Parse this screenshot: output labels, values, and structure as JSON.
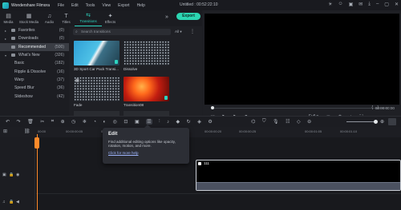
{
  "window": {
    "app_name": "Wondershare Filmora",
    "menu": [
      "File",
      "Edit",
      "Tools",
      "View",
      "Export",
      "Help"
    ],
    "title": "Untitled : 00:52:22:10"
  },
  "toolbar": {
    "tabs": [
      {
        "label": "Media",
        "icon": "media-icon"
      },
      {
        "label": "Stock Media",
        "icon": "stock-media-icon"
      },
      {
        "label": "Audio",
        "icon": "audio-icon"
      },
      {
        "label": "Titles",
        "icon": "titles-icon"
      },
      {
        "label": "Transitions",
        "icon": "transitions-icon"
      },
      {
        "label": "Effects",
        "icon": "effects-icon"
      }
    ],
    "active_tab": "Transitions",
    "export_label": "Export",
    "accent": "#2dd4c0"
  },
  "nav": {
    "items": [
      {
        "label": "Favorites",
        "count": "(0)"
      },
      {
        "label": "Downloads",
        "count": "(0)"
      },
      {
        "label": "Recommended",
        "count": "(500)",
        "selected": true
      },
      {
        "label": "What's New",
        "count": "(326)"
      },
      {
        "label": "Basic",
        "count": "(182)"
      },
      {
        "label": "Ripple & Dissolve",
        "count": "(16)"
      },
      {
        "label": "Warp",
        "count": "(37)"
      },
      {
        "label": "Speed Blur",
        "count": "(36)"
      },
      {
        "label": "Slideshow",
        "count": "(42)"
      }
    ]
  },
  "assets": {
    "search_placeholder": "Search transitions",
    "filter_value": "All",
    "items": [
      {
        "label": "3D Sport Car Pack Transi..."
      },
      {
        "label": "Dissolve"
      },
      {
        "label": "Fade"
      },
      {
        "label": "Transition08"
      }
    ]
  },
  "preview": {
    "timecode": "00:00:00:00",
    "quality": "Full"
  },
  "timeline": {
    "ruler": [
      "00:00",
      "00:00:00:05",
      "00:00:00:10",
      "00:00:00:15",
      "00:00:00:20",
      "00:00:00:25",
      "00:00:01:05",
      "00:00:01:10"
    ],
    "clip_name": "111"
  },
  "tooltip": {
    "title": "Edit",
    "description": "Find additional editing options like opacity, rotation, motion, and more.",
    "link": "Click for more help"
  }
}
